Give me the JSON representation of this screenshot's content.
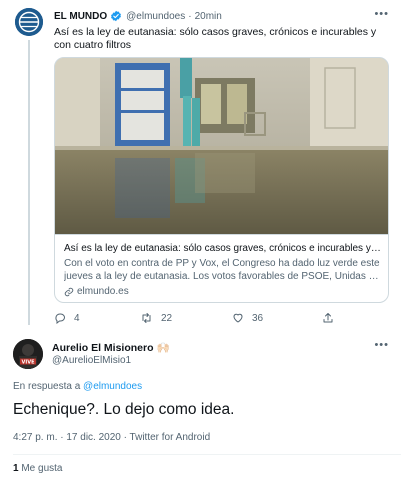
{
  "parent_tweet": {
    "author_name": "EL MUNDO",
    "handle": "@elmundoes",
    "separator": "·",
    "time": "20min",
    "text": "Así es la ley de eutanasia: sólo casos graves, crónicos e incurables y con cuatro filtros",
    "card": {
      "title": "Así es la ley de eutanasia: sólo casos graves, crónicos e incurables y…",
      "description": "Con el voto en contra de PP y Vox, el Congreso ha dado luz verde este jueves a la ley de eutanasia. Los votos favorables de PSOE, Unidas …",
      "domain": "elmundo.es"
    },
    "counts": {
      "replies": "4",
      "retweets": "22",
      "likes": "36"
    }
  },
  "reply_tweet": {
    "author_name": "Aurelio El Misionero",
    "author_emoji": "🙌🏻",
    "handle": "@AurelioElMisio1",
    "replying_prefix": "En respuesta a",
    "replying_to": "@elmundoes",
    "text": "Echenique?. Lo dejo como idea.",
    "meta": "4:27 p. m. · 17 dic. 2020 · Twitter for Android",
    "likes_count": "1",
    "likes_label": "Me gusta",
    "avatar_text": "VIVE"
  },
  "colors": {
    "text": "#0f1419",
    "muted": "#536471",
    "accent": "#1d9bf0",
    "border": "#cfd9de",
    "elmundo_avatar": "#1e5b8f"
  },
  "icons": [
    "elmundo-globe-icon",
    "verified-badge-icon",
    "more-icon",
    "link-icon",
    "reply-icon",
    "retweet-icon",
    "like-icon",
    "share-icon"
  ]
}
